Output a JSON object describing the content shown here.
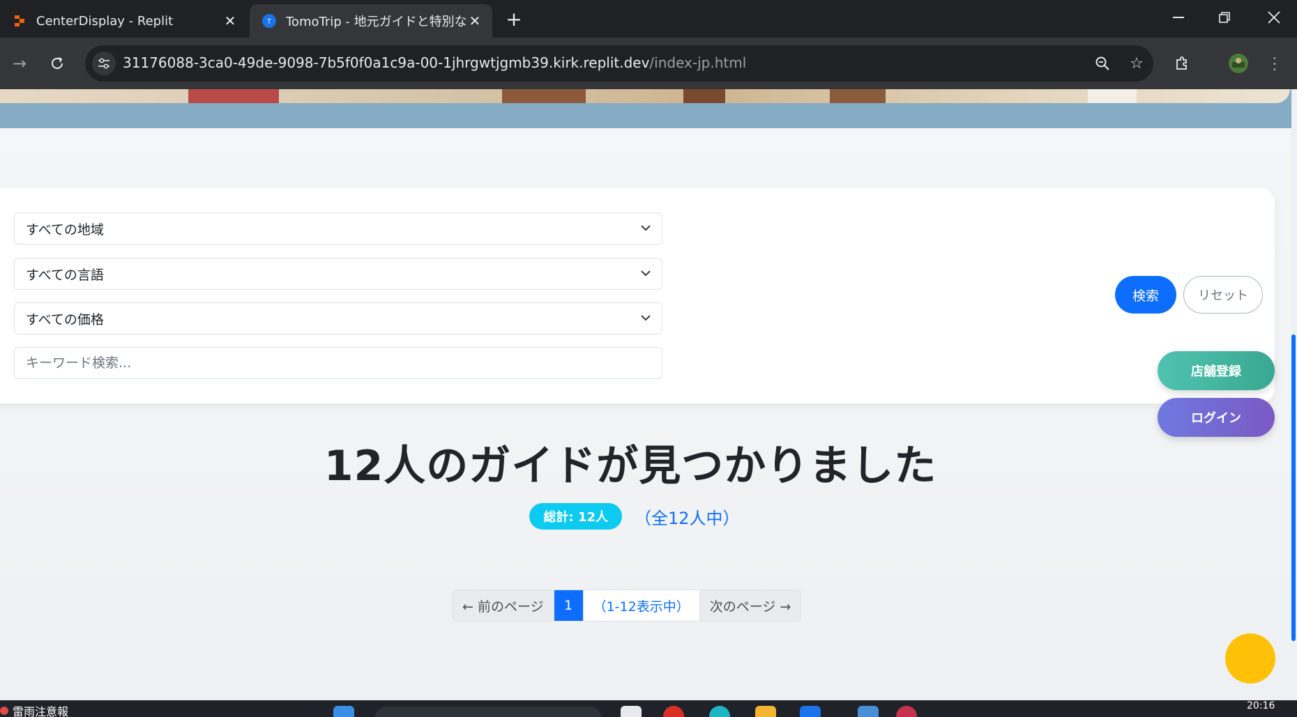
{
  "browser": {
    "tabs": [
      {
        "title": "CenterDisplay - Replit",
        "active": false,
        "icon": "replit-icon"
      },
      {
        "title": "TomoTrip - 地元ガイドと特別な旅",
        "active": true,
        "icon": "tomotrip-icon"
      }
    ],
    "new_tab": "+",
    "url_host": "31176088-3ca0-49de-9098-7b5f0f0a1c9a-00-1jhrgwtjgmb39.kirk.replit.dev",
    "url_path": "/index-jp.html"
  },
  "search": {
    "region": "すべての地域",
    "language": "すべての言語",
    "price": "すべての価格",
    "keyword_placeholder": "キーワード検索...",
    "search_button": "検索",
    "reset_button": "リセット"
  },
  "floating": {
    "store_register": "店舗登録",
    "login": "ログイン"
  },
  "results": {
    "title": "12人のガイドが見つかりました",
    "badge": "総計: 12人",
    "total_text": "（全12人中）"
  },
  "pagination": {
    "prev": "← 前のページ",
    "current": "1",
    "info": "（1-12表示中）",
    "next": "次のページ →"
  },
  "taskbar": {
    "weather_text": "雷雨注意報",
    "time": "20:16"
  },
  "colors": {
    "primary": "#0d6efd",
    "info": "#0dcaf0",
    "store_button": "#4fc3b0",
    "login_button": "#7b59c4",
    "fab": "#ffc107"
  }
}
